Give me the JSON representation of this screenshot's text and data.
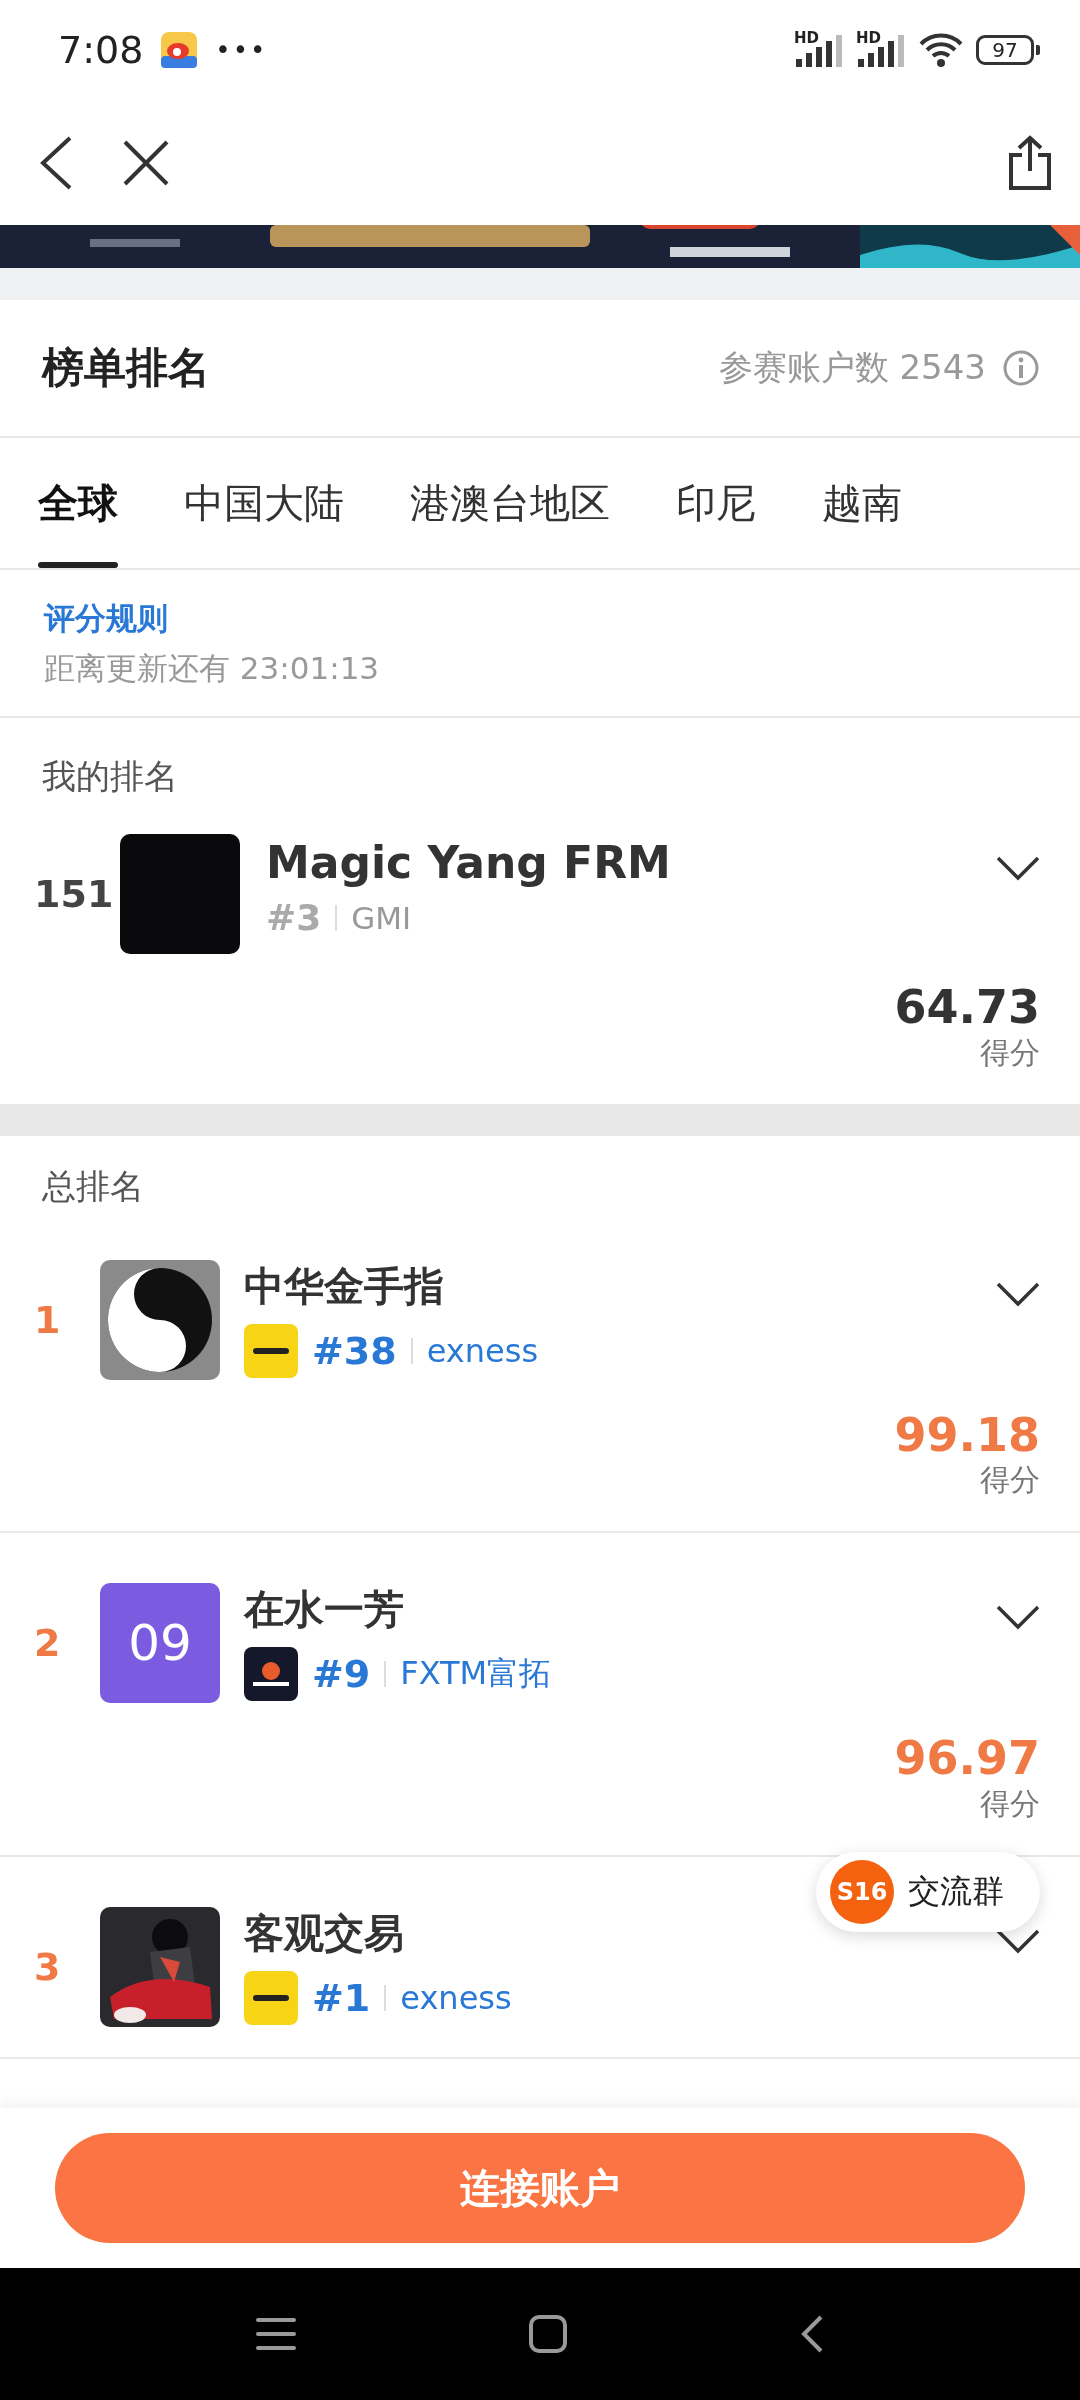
{
  "status_bar": {
    "time": "7:08",
    "more": "•••",
    "signal_labels": [
      "HD",
      "HD"
    ],
    "battery": "97"
  },
  "leaderboard": {
    "title": "榜单排名",
    "participants": "参赛账户数 2543"
  },
  "tabs": [
    {
      "label": "全球",
      "selected": true
    },
    {
      "label": "中国大陆",
      "selected": false
    },
    {
      "label": "港澳台地区",
      "selected": false
    },
    {
      "label": "印尼",
      "selected": false
    },
    {
      "label": "越南",
      "selected": false
    }
  ],
  "rules": {
    "link": "评分规则",
    "countdown": "距离更新还有 23:01:13"
  },
  "my_ranking": {
    "heading": "我的排名",
    "entry": {
      "rank": "151",
      "name": "Magic Yang FRM",
      "avatar": {
        "kind": "blank"
      },
      "broker_rank": "#3",
      "broker": "GMI",
      "score": "64.73",
      "score_label": "得分"
    }
  },
  "total_ranking": {
    "heading": "总排名",
    "entries": [
      {
        "rank": "1",
        "name": "中华金手指",
        "broker_logo": {
          "kind": "exness"
        },
        "broker_rank": "#38",
        "broker": "exness",
        "score": "99.18",
        "score_label": "得分"
      },
      {
        "rank": "2",
        "name": "在水一芳",
        "avatar": {
          "kind": "text",
          "text": "09"
        },
        "broker_logo": {
          "kind": "fxtm"
        },
        "broker_rank": "#9",
        "broker": "FXTM富拓",
        "score": "96.97",
        "score_label": "得分"
      },
      {
        "rank": "3",
        "name": "客观交易",
        "broker_logo": {
          "kind": "exness"
        },
        "broker_rank": "#1",
        "broker": "exness"
      }
    ]
  },
  "chat_button": {
    "badge": "S16",
    "label": "交流群"
  },
  "connect_button": {
    "label": "连接账户"
  }
}
